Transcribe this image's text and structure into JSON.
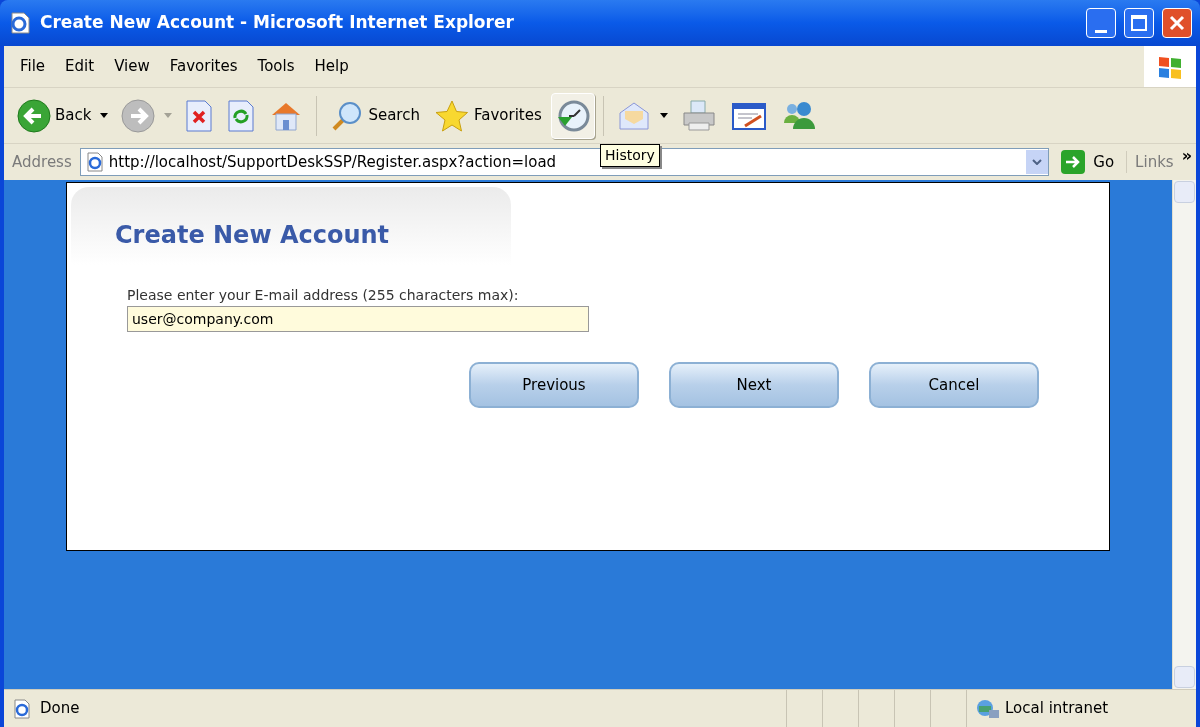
{
  "window": {
    "title": "Create New Account - Microsoft Internet Explorer"
  },
  "menu": [
    "File",
    "Edit",
    "View",
    "Favorites",
    "Tools",
    "Help"
  ],
  "toolbar": [
    {
      "kind": "back",
      "label": "Back",
      "dropdown": true
    },
    {
      "kind": "forward",
      "dropdown": true
    },
    {
      "kind": "stop"
    },
    {
      "kind": "refresh"
    },
    {
      "kind": "home"
    },
    {
      "kind": "separator"
    },
    {
      "kind": "search",
      "label": "Search"
    },
    {
      "kind": "favorites",
      "label": "Favorites"
    },
    {
      "kind": "history",
      "hovered": true
    },
    {
      "kind": "separator"
    },
    {
      "kind": "mail",
      "dropdown": true
    },
    {
      "kind": "print"
    },
    {
      "kind": "edit"
    },
    {
      "kind": "messenger"
    }
  ],
  "tooltip": "History",
  "address_bar": {
    "label": "Address",
    "url": "http://localhost/SupportDeskSSP/Register.aspx?action=load",
    "go": "Go",
    "links": "Links",
    "more": "»"
  },
  "page": {
    "title": "Create New Account",
    "prompt": "Please enter your E-mail address (255 characters max):",
    "email": "user@company.com",
    "buttons": [
      "Previous",
      "Next",
      "Cancel"
    ]
  },
  "status_bar": {
    "text": "Done",
    "zone": "Local intranet"
  }
}
